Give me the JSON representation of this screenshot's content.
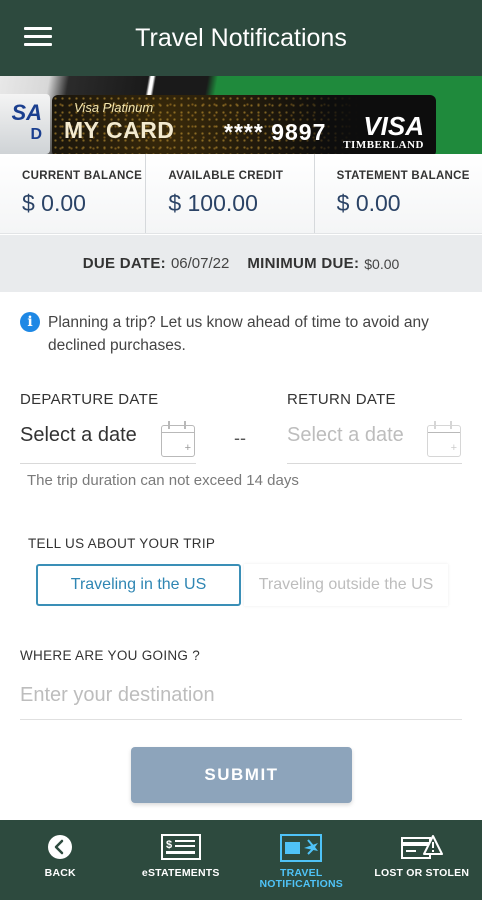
{
  "header": {
    "title": "Travel Notifications"
  },
  "card": {
    "subtitle": "Visa Platinum",
    "name": "MY CARD",
    "number": "**** 9897",
    "brand": "VISA",
    "bank": "TIMBERLAND",
    "side_text": "SA",
    "side_text2": "D"
  },
  "balances": [
    {
      "label": "CURRENT BALANCE",
      "value": "$ 0.00"
    },
    {
      "label": "AVAILABLE CREDIT",
      "value": "$ 100.00"
    },
    {
      "label": "STATEMENT BALANCE",
      "value": "$ 0.00"
    }
  ],
  "due": {
    "due_label": "DUE DATE:",
    "due_value": "06/07/22",
    "min_label": "MINIMUM DUE:",
    "min_value": "$0.00"
  },
  "info": {
    "icon": "info-icon",
    "text": "Planning a trip? Let us know ahead of time to avoid any declined purchases."
  },
  "dates": {
    "departure_label": "DEPARTURE DATE",
    "return_label": "RETURN DATE",
    "departure_placeholder": "Select a date",
    "return_placeholder": "Select a date",
    "separator": "--",
    "hint": "The trip duration can not exceed 14 days"
  },
  "trip": {
    "label": "TELL US ABOUT YOUR TRIP",
    "option_us": "Traveling in the US",
    "option_outside": "Traveling outside the US",
    "selected": "Traveling in the US"
  },
  "destination": {
    "label": "WHERE ARE YOU GOING ?",
    "placeholder": "Enter your destination",
    "value": ""
  },
  "submit_label": "SUBMIT",
  "nav": [
    {
      "label": "BACK",
      "icon": "back-icon"
    },
    {
      "label": "eSTATEMENTS",
      "icon": "statement-icon"
    },
    {
      "label": "TRAVEL NOTIFICATIONS",
      "icon": "travel-card-icon",
      "active": true
    },
    {
      "label": "LOST OR STOLEN",
      "icon": "lost-card-warning-icon"
    }
  ],
  "colors": {
    "header_bg": "#2d4a3e",
    "accent_blue": "#3a8fb7",
    "balance_value": "#2b4366",
    "submit_bg": "#8da4bb",
    "nav_active": "#4fc3f7"
  }
}
